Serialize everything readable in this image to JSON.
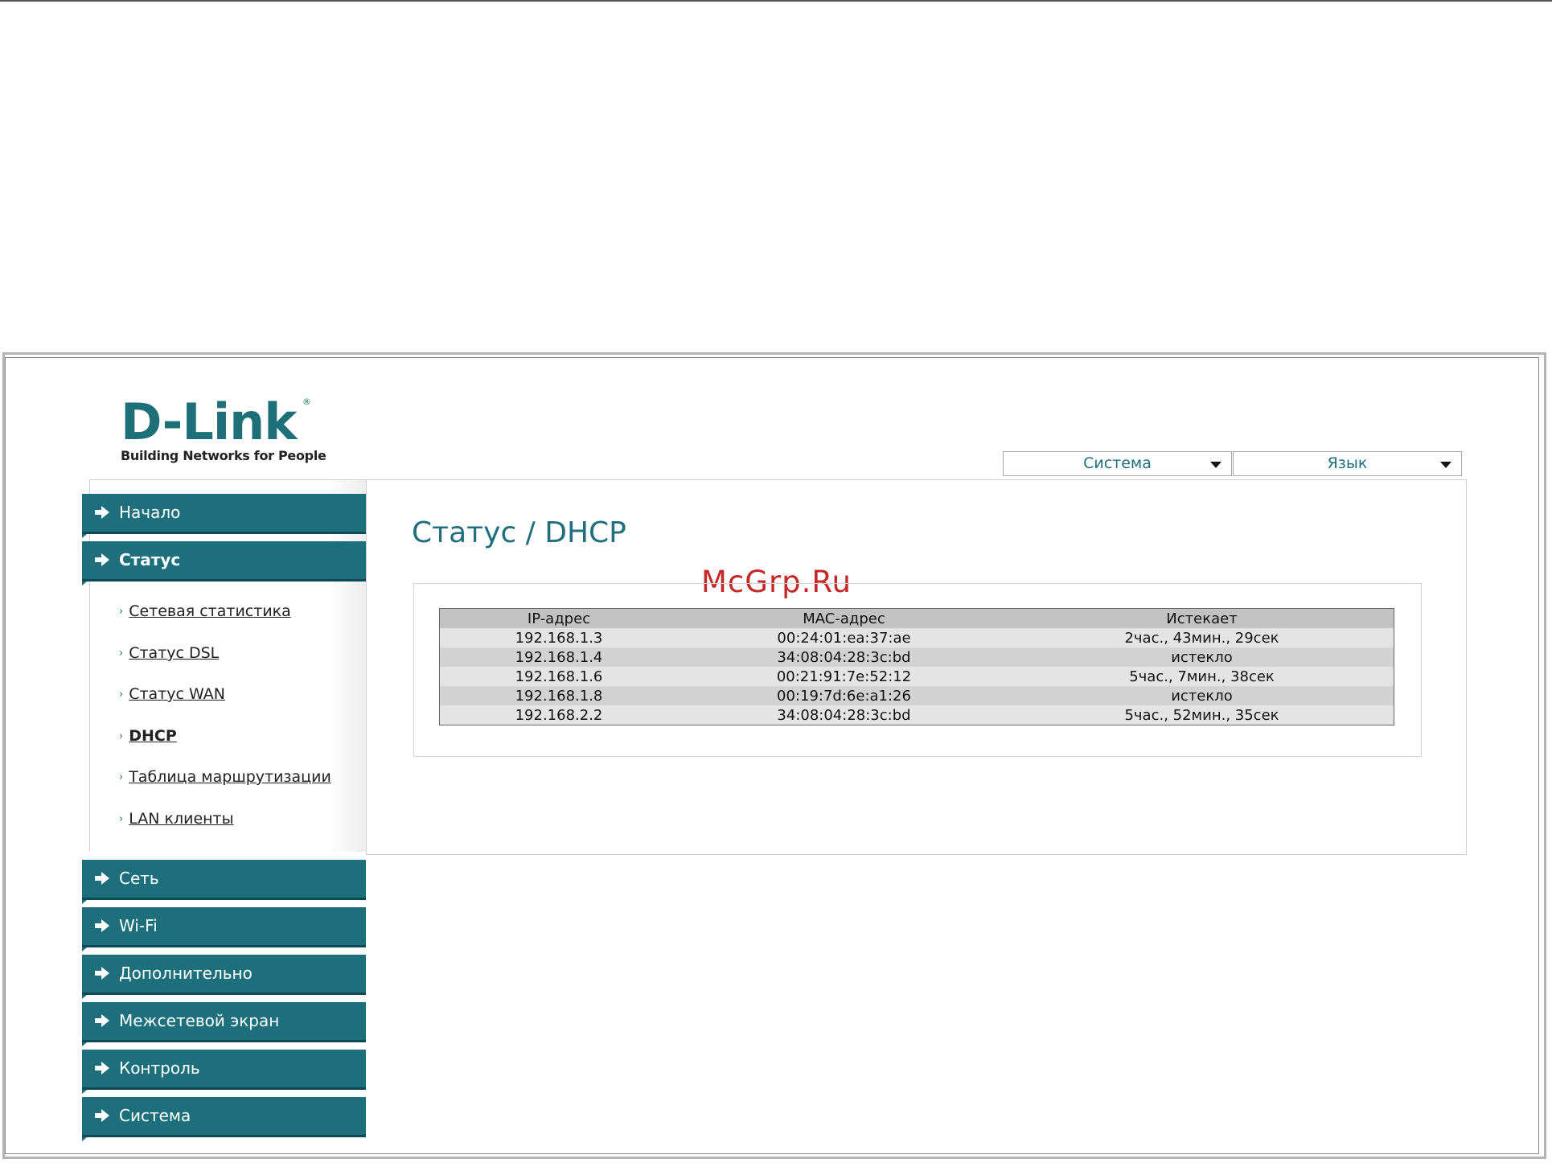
{
  "header": {
    "logo_brand": "D-Link",
    "logo_registered": "®",
    "logo_tagline": "Building Networks for People",
    "system_select": "Система",
    "language_select": "Язык"
  },
  "sidebar": {
    "menu": [
      {
        "label": "Начало",
        "active": false
      },
      {
        "label": "Статус",
        "active": true
      },
      {
        "label": "Сеть",
        "active": false
      },
      {
        "label": "Wi-Fi",
        "active": false
      },
      {
        "label": "Дополнительно",
        "active": false
      },
      {
        "label": "Межсетевой экран",
        "active": false
      },
      {
        "label": "Контроль",
        "active": false
      },
      {
        "label": "Система",
        "active": false
      }
    ],
    "submenu": [
      {
        "label": "Сетевая статистика",
        "current": false
      },
      {
        "label": "Статус DSL",
        "current": false
      },
      {
        "label": "Статус WAN",
        "current": false
      },
      {
        "label": "DHCP",
        "current": true
      },
      {
        "label": "Таблица маршрутизации",
        "current": false
      },
      {
        "label": "LAN клиенты",
        "current": false
      }
    ]
  },
  "main": {
    "title": "Статус / DHCP",
    "watermark": "McGrp.Ru",
    "table": {
      "headers": [
        "IP-адрес",
        "MAC-адрес",
        "Истекает"
      ],
      "rows": [
        [
          "192.168.1.3",
          "00:24:01:ea:37:ae",
          "2час., 43мин., 29сек"
        ],
        [
          "192.168.1.4",
          "34:08:04:28:3c:bd",
          "истекло"
        ],
        [
          "192.168.1.6",
          "00:21:91:7e:52:12",
          "5час., 7мин., 38сек"
        ],
        [
          "192.168.1.8",
          "00:19:7d:6e:a1:26",
          "истекло"
        ],
        [
          "192.168.2.2",
          "34:08:04:28:3c:bd",
          "5час., 52мин., 35сек"
        ]
      ]
    }
  },
  "colors": {
    "accent": "#1c6f7b",
    "title": "#1f6f7d",
    "watermark": "#c62828"
  }
}
